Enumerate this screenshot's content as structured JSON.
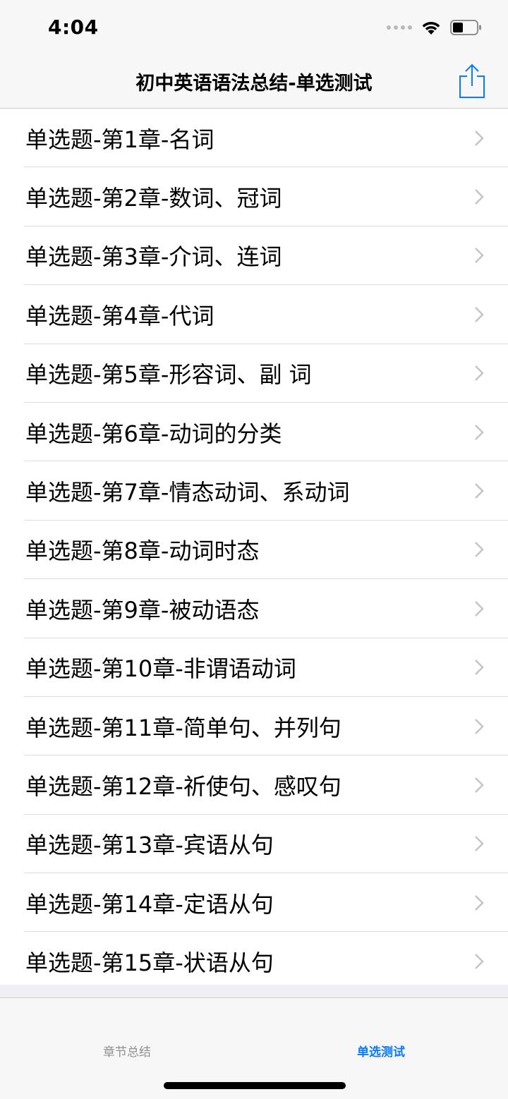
{
  "status_bar": {
    "time": "4:04"
  },
  "nav": {
    "title": "初中英语语法总结-单选测试"
  },
  "items": [
    "单选题-第1章-名词",
    "单选题-第2章-数词、冠词",
    "单选题-第3章-介词、连词",
    "单选题-第4章-代词",
    "单选题-第5章-形容词、副 词",
    "单选题-第6章-动词的分类",
    "单选题-第7章-情态动词、系动词",
    "单选题-第8章-动词时态",
    "单选题-第9章-被动语态",
    "单选题-第10章-非谓语动词",
    "单选题-第11章-简单句、并列句",
    "单选题-第12章-祈使句、感叹句",
    "单选题-第13章-宾语从句",
    "单选题-第14章-定语从句",
    "单选题-第15章-状语从句"
  ],
  "tabs": [
    {
      "label": "章节总结",
      "active": false
    },
    {
      "label": "单选测试",
      "active": true
    }
  ],
  "colors": {
    "accent": "#0a7aff",
    "inactive_tab": "#8e8e93",
    "chevron": "#c4c4c7"
  },
  "icons": {
    "share": "share-icon",
    "chevron": "chevron-right-icon",
    "wifi": "wifi-icon",
    "battery": "battery-icon"
  }
}
